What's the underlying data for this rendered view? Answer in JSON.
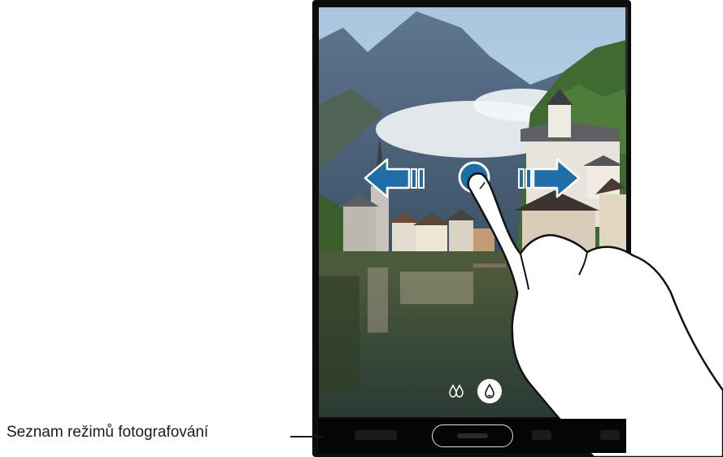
{
  "caption": {
    "mode_list_label": "Seznam režimů fotografování"
  },
  "camera": {
    "modes": [
      "",
      "",
      "",
      ""
    ],
    "selected_mode_index": 1,
    "filter_icons": [
      "drops-outline-icon",
      "drop-filled-icon"
    ],
    "gesture": "swipe-left-right"
  },
  "colors": {
    "arrow": "#1e6fa8",
    "phone_body": "#0d0d0d",
    "caption_text": "#1a1a1a"
  }
}
